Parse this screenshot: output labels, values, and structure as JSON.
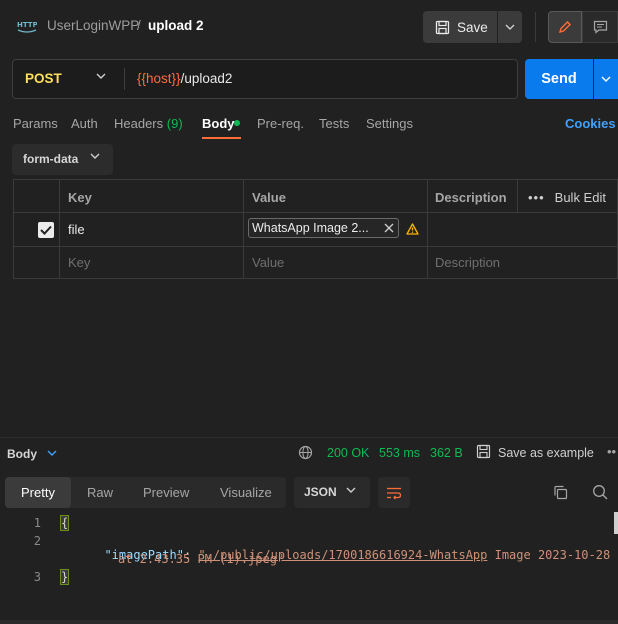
{
  "header": {
    "collection": "UserLoginWPP",
    "separator": "/",
    "request_name": "upload 2",
    "save_label": "Save"
  },
  "request": {
    "method": "POST",
    "url_variable": "{{host}}",
    "url_path": "/upload2",
    "send_label": "Send"
  },
  "tabs": {
    "params": "Params",
    "auth": "Auth",
    "headers": "Headers",
    "headers_count": "(9)",
    "body": "Body",
    "prereq": "Pre-req.",
    "tests": "Tests",
    "settings": "Settings",
    "cookies": "Cookies"
  },
  "body_mode": "form-data",
  "params_table": {
    "headers": {
      "key": "Key",
      "value": "Value",
      "description": "Description",
      "bulk_edit": "Bulk Edit"
    },
    "rows": [
      {
        "checked": true,
        "key": "file",
        "value": "WhatsApp Image 2..."
      }
    ],
    "placeholder": {
      "key": "Key",
      "value": "Value",
      "description": "Description"
    }
  },
  "response": {
    "label": "Body",
    "status": "200 OK",
    "time": "553 ms",
    "size": "362 B",
    "save_example": "Save as example",
    "view_tabs": [
      "Pretty",
      "Raw",
      "Preview",
      "Visualize"
    ],
    "format": "JSON",
    "lines": [
      "1",
      "2",
      "3"
    ],
    "open_brace": "{",
    "close_brace": "}",
    "json_key": "\"imagePath\"",
    "colon": ": ",
    "json_value_part1": "\"./public/uploads/1700186616924-WhatsApp",
    "json_value_part2": " Image 2023-10-28",
    "json_value_part3": "at 2.43.35 PM (1).jpeg\""
  },
  "colors": {
    "accent": "#ff6c37",
    "send": "#097bed",
    "success": "#0cbb52",
    "method": "#ffdf5d",
    "link": "#3fa2ff"
  }
}
